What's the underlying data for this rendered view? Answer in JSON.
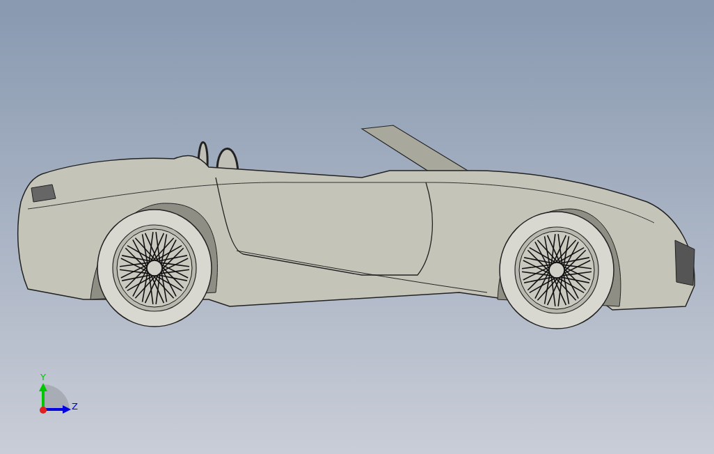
{
  "viewport": {
    "model": {
      "kind": "car"
    },
    "triad": {
      "axes": [
        {
          "label": "Y",
          "color": "#00c800",
          "kind": "vertical"
        },
        {
          "label": "Z",
          "color": "#0000e0",
          "kind": "horizontal"
        }
      ]
    }
  }
}
